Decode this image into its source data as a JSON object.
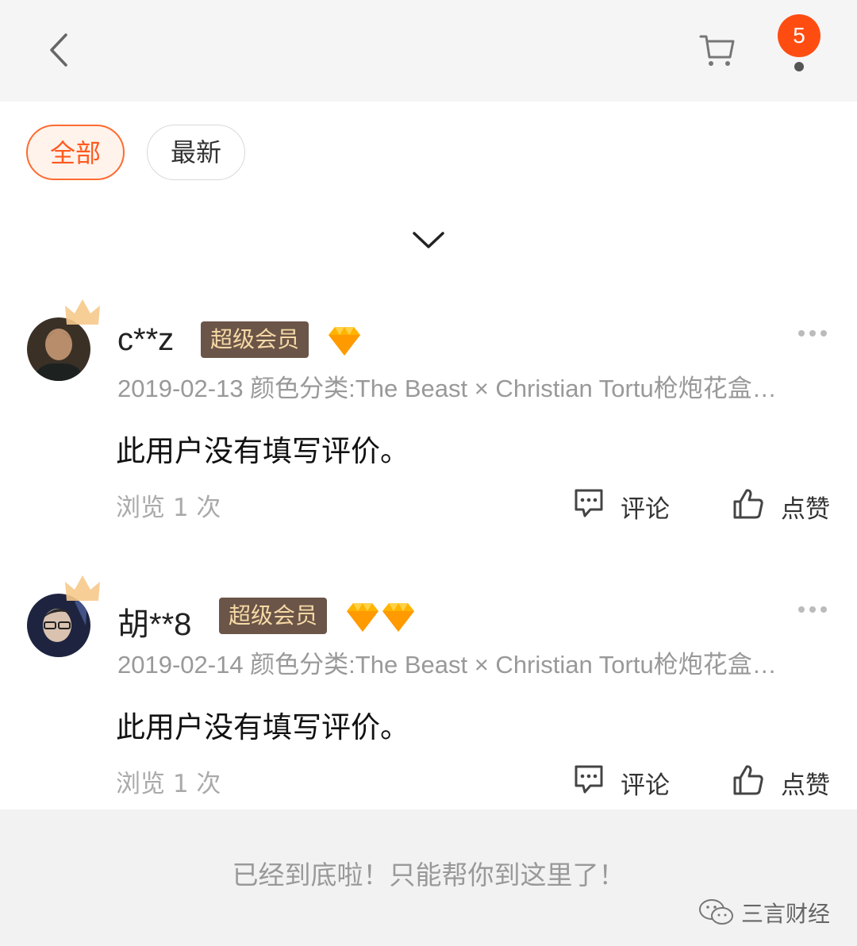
{
  "header": {
    "back_icon": "chevron-left-icon",
    "cart_icon": "cart-icon",
    "message_badge": "5"
  },
  "filters": [
    {
      "label": "全部",
      "active": true
    },
    {
      "label": "最新",
      "active": false
    }
  ],
  "expand_icon": "chevron-down-icon",
  "reviews": [
    {
      "user": "c**z",
      "vip_label": "超级会员",
      "diamonds": 1,
      "meta": "2019-02-13 颜色分类:The Beast × Christian Tortu枪炮花盒…",
      "content": "此用户没有填写评价。",
      "views": "浏览 1 次",
      "comment_label": "评论",
      "like_label": "点赞"
    },
    {
      "user": "胡**8",
      "vip_label": "超级会员",
      "diamonds": 2,
      "meta": "2019-02-14 颜色分类:The Beast × Christian Tortu枪炮花盒…",
      "content": "此用户没有填写评价。",
      "views": "浏览 1 次",
      "comment_label": "评论",
      "like_label": "点赞"
    }
  ],
  "footer": {
    "end_text": "已经到底啦！只能帮你到这里了！",
    "watermark": "三言财经"
  },
  "colors": {
    "accent": "#ff5a1f",
    "vip_bg": "#6b5548",
    "vip_text": "#f6d9a6",
    "badge": "#ff4d12"
  }
}
